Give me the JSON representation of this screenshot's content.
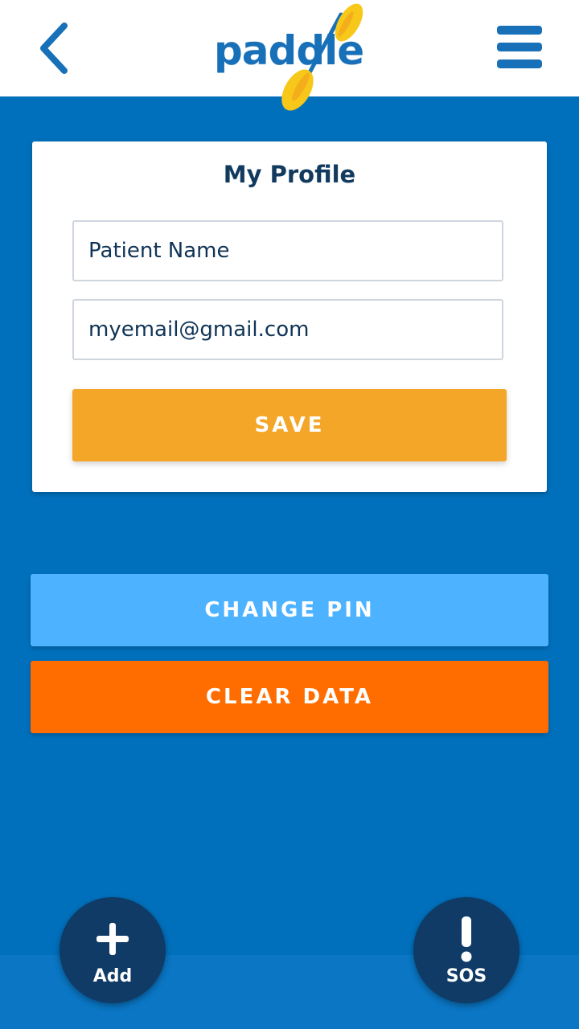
{
  "header": {
    "back_icon": "chevron-left-icon",
    "menu_icon": "hamburger-menu-icon",
    "logo_text": "paddle",
    "logo_icon": "paddle-oar-icon"
  },
  "profile": {
    "title": "My Profile",
    "name_value": "Patient Name",
    "email_value": "myemail@gmail.com",
    "save_label": "SAVE"
  },
  "actions": {
    "change_pin_label": "CHANGE PIN",
    "clear_data_label": "CLEAR DATA"
  },
  "bottom": {
    "add_label": "Add",
    "add_icon": "plus-icon",
    "sos_label": "SOS",
    "sos_icon": "exclamation-icon"
  },
  "colors": {
    "background": "#0070bc",
    "header": "#ffffff",
    "brand_blue": "#1870b8",
    "save": "#f4a628",
    "change_pin": "#4db2ff",
    "clear_data": "#ff6c00",
    "fab": "#0f3b66",
    "logo_yellow": "#f7c71a"
  }
}
